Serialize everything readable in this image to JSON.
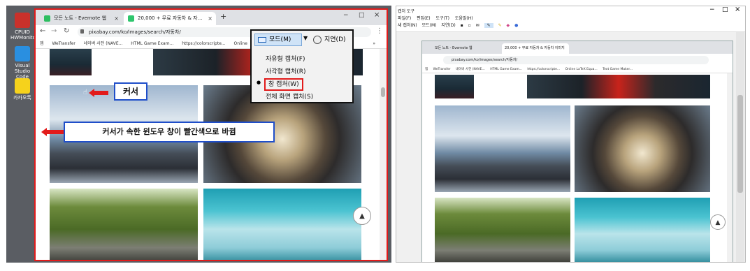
{
  "left": {
    "desktop_icons": [
      {
        "label": "CPUID HWMonitor",
        "icon": "cpuid-icon",
        "color": "#c9312b"
      },
      {
        "label": "Visual Studio Code",
        "icon": "vscode-icon",
        "color": "#2a8fe0"
      },
      {
        "label": "카카오톡",
        "icon": "kakaotalk-icon",
        "color": "#f6d21c"
      }
    ],
    "browser": {
      "tabs": [
        {
          "label": "모든 노트 - Evernote 웹",
          "close": "×"
        },
        {
          "label": "20,000 + 무료 자동차 & 자동차 이미지",
          "close": "×"
        }
      ],
      "new_tab": "+",
      "window_controls": {
        "minimize": "−",
        "maximize": "□",
        "close": "×"
      },
      "url": "pixabay.com/ko/images/search/자동차/",
      "bookmarks": [
        "앱",
        "WeTransfer",
        "네이버 사전 (NAVE...",
        "HTML Game Exam...",
        "https://colorscripte...",
        "Online"
      ],
      "bookmarks_more": "»"
    },
    "capture_menu": {
      "mode_label": "모드(M)",
      "delay_label": "지연(D)",
      "items": [
        "자유형 캡처(F)",
        "사각형 캡처(R)",
        "창 캡처(W)",
        "전체 화면 캡처(S)"
      ],
      "selected_index": 2,
      "bullet": "●"
    },
    "callouts": {
      "cursor": "커서",
      "window": "커서가 속한 윈도우 창이 빨간색으로 바뀜"
    },
    "scroll_top_icon": "▲"
  },
  "right": {
    "title": "캡처 도구",
    "window_controls": {
      "minimize": "−",
      "maximize": "□",
      "close": "×"
    },
    "menu": [
      "파일(F)",
      "편집(E)",
      "도구(T)",
      "도움말(H)"
    ],
    "toolbar": [
      "새 캡처(N)",
      "모드(M)",
      "지연(D)"
    ],
    "inner_browser": {
      "tabs": [
        "모든 노트 - Evernote 웹",
        "20,000 + 무료 자동차 & 자동차 이미지"
      ],
      "url": "pixabay.com/ko/images/search/자동차/",
      "bookmarks": [
        "앱",
        "WeTransfer",
        "네이버 사전 (NAVE...",
        "HTML Game Exam...",
        "https://colorscripte...",
        "Online LaTeX Equa...",
        "Text Game Maker..."
      ],
      "scroll_top_icon": "▲"
    }
  },
  "colors": {
    "highlight_red": "#e21b1b",
    "callout_blue": "#1f4ec9",
    "tab_bar": "#dfe1e5"
  }
}
